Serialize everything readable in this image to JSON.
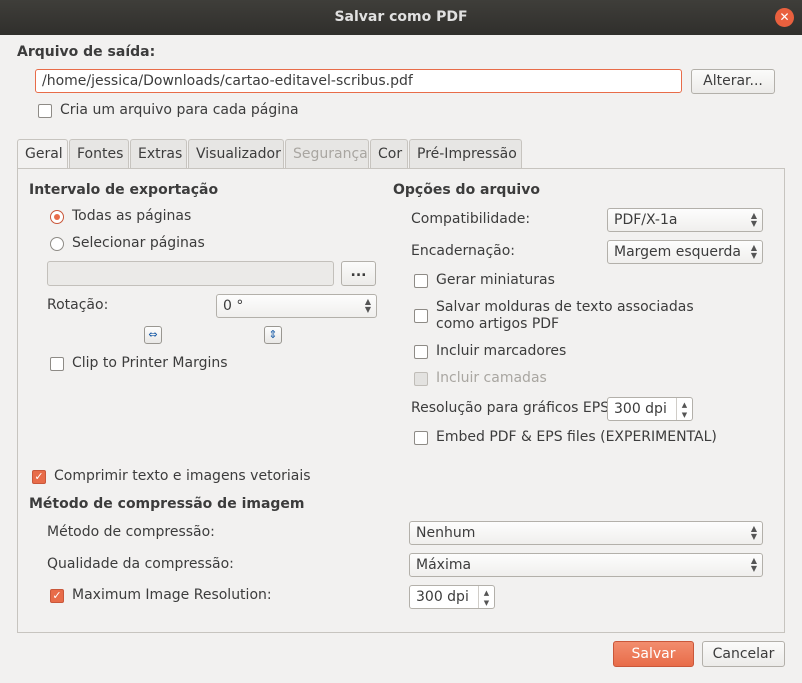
{
  "window": {
    "title": "Salvar como PDF"
  },
  "output": {
    "section_label": "Arquivo de saída:",
    "path": "/home/jessica/Downloads/cartao-editavel-scribus.pdf",
    "change_button": "Alterar...",
    "per_page_label": "Cria um arquivo para cada página",
    "per_page_checked": false
  },
  "tabs": [
    {
      "label": "Geral",
      "active": true,
      "disabled": false
    },
    {
      "label": "Fontes",
      "active": false,
      "disabled": false
    },
    {
      "label": "Extras",
      "active": false,
      "disabled": false
    },
    {
      "label": "Visualizador",
      "active": false,
      "disabled": false
    },
    {
      "label": "Segurança",
      "active": false,
      "disabled": true
    },
    {
      "label": "Cor",
      "active": false,
      "disabled": false
    },
    {
      "label": "Pré-Impressão",
      "active": false,
      "disabled": false
    }
  ],
  "export_range": {
    "heading": "Intervalo de exportação",
    "all_pages": "Todas as páginas",
    "select_pages": "Selecionar páginas",
    "selected": "all_pages",
    "page_input": "",
    "browse_button": "...",
    "rotation_label": "Rotação:",
    "rotation_value": "0 °",
    "clip_label": "Clip to Printer Margins",
    "clip_checked": false
  },
  "file_options": {
    "heading": "Opções do arquivo",
    "compat_label": "Compatibilidade:",
    "compat_value": "PDF/X-1a",
    "binding_label": "Encadernação:",
    "binding_value": "Margem esquerda",
    "thumbnails_label": "Gerar miniaturas",
    "thumbnails_checked": false,
    "text_frames_label_1": "Salvar molduras de texto associadas",
    "text_frames_label_2": "como artigos PDF",
    "text_frames_checked": false,
    "bookmarks_label": "Incluir marcadores",
    "bookmarks_checked": false,
    "layers_label": "Incluir camadas",
    "layers_checked": false,
    "eps_res_label": "Resolução para gráficos EPS:",
    "eps_res_value": "300 dpi",
    "embed_label": "Embed PDF & EPS files (EXPERIMENTAL)",
    "embed_checked": false
  },
  "compression": {
    "compress_label": "Comprimir texto e imagens vetoriais",
    "compress_checked": true,
    "heading": "Método de compressão de imagem",
    "method_label": "Método de compressão:",
    "method_value": "Nenhum",
    "quality_label": "Qualidade da compressão:",
    "quality_value": "Máxima",
    "max_res_label": "Maximum Image Resolution:",
    "max_res_checked": true,
    "max_res_value": "300 dpi"
  },
  "footer": {
    "save_button": "Salvar",
    "cancel_button": "Cancelar"
  },
  "colors": {
    "accent": "#e86c49",
    "titlebar": "#3a3935",
    "background": "#f2f1f0"
  },
  "icons": {
    "close": "close-icon",
    "rotate_horizontal": "flip-horizontal-icon",
    "rotate_vertical": "flip-vertical-icon",
    "combo_arrows": "updown-arrows-icon",
    "spin_arrows": "spinner-arrows-icon"
  }
}
